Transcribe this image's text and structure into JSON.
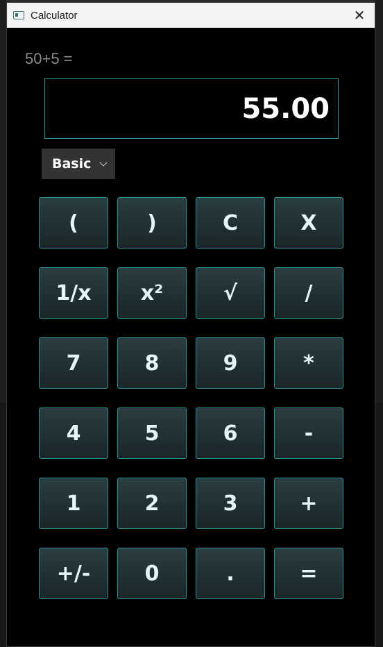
{
  "window": {
    "title": "Calculator",
    "icon": "calculator-app-icon",
    "close_icon": "close-icon"
  },
  "expression": "50+5 =",
  "display": {
    "value": "55.00"
  },
  "mode": {
    "selected": "Basic"
  },
  "colors": {
    "accent": "#2a8f93",
    "button_bg": "#22333a",
    "window_bg": "#000000",
    "text": "#e4f6f6"
  },
  "keys": [
    {
      "label": "(",
      "name": "open-paren-button"
    },
    {
      "label": ")",
      "name": "close-paren-button"
    },
    {
      "label": "C",
      "name": "clear-button"
    },
    {
      "label": "X",
      "name": "delete-button"
    },
    {
      "label": "1/x",
      "name": "reciprocal-button"
    },
    {
      "label": "x²",
      "name": "square-button"
    },
    {
      "label": "√",
      "name": "sqrt-button"
    },
    {
      "label": "/",
      "name": "divide-button"
    },
    {
      "label": "7",
      "name": "digit-7-button"
    },
    {
      "label": "8",
      "name": "digit-8-button"
    },
    {
      "label": "9",
      "name": "digit-9-button"
    },
    {
      "label": "*",
      "name": "multiply-button"
    },
    {
      "label": "4",
      "name": "digit-4-button"
    },
    {
      "label": "5",
      "name": "digit-5-button"
    },
    {
      "label": "6",
      "name": "digit-6-button"
    },
    {
      "label": "-",
      "name": "subtract-button"
    },
    {
      "label": "1",
      "name": "digit-1-button"
    },
    {
      "label": "2",
      "name": "digit-2-button"
    },
    {
      "label": "3",
      "name": "digit-3-button"
    },
    {
      "label": "+",
      "name": "add-button"
    },
    {
      "label": "+/-",
      "name": "negate-button"
    },
    {
      "label": "0",
      "name": "digit-0-button"
    },
    {
      "label": ".",
      "name": "decimal-button"
    },
    {
      "label": "=",
      "name": "equals-button"
    }
  ]
}
